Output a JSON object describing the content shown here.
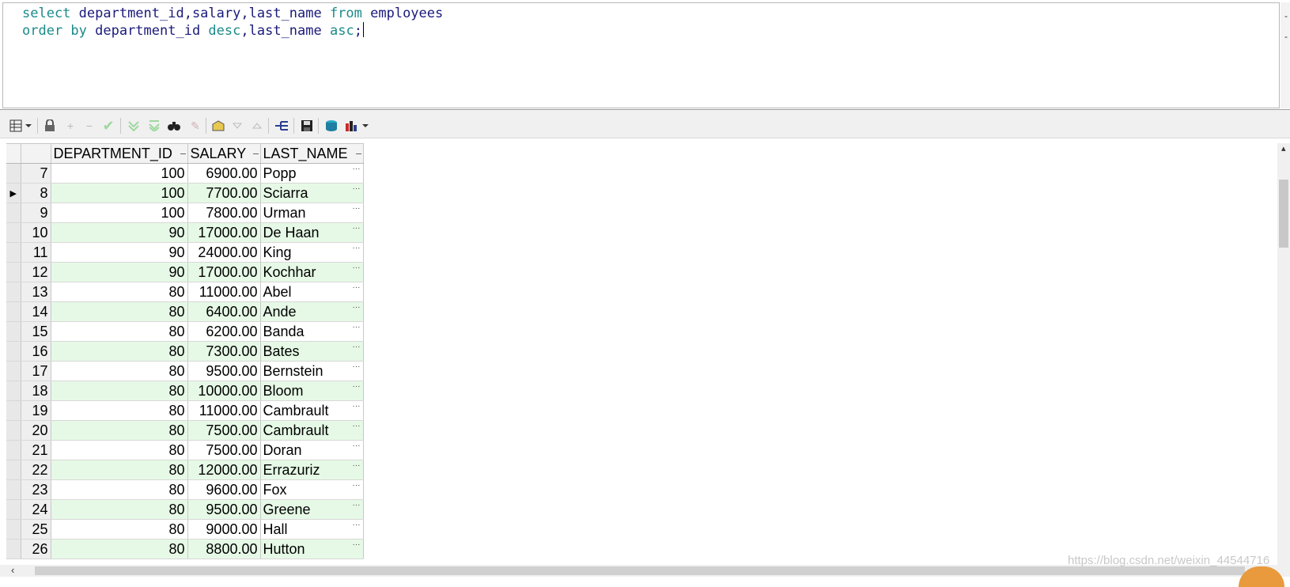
{
  "editor": {
    "line1": {
      "kw1": "select",
      "t1": " department_id,salary,last_name ",
      "kw2": "from",
      "t2": " employees"
    },
    "line2": {
      "kw1": "order by",
      "t1": " department_id ",
      "kw2": "desc",
      "t2": ",last_name ",
      "kw3": "asc",
      "t3": ";"
    }
  },
  "toolbar": {
    "icons": [
      "grid-view-icon",
      "dropdown-icon",
      "lock-icon",
      "add-row-icon",
      "delete-row-icon",
      "post-changes-icon",
      "fetch-next-icon",
      "fetch-all-icon",
      "find-icon",
      "clear-icon",
      "export-icon",
      "sort-desc-icon",
      "sort-asc-icon",
      "query-structure-icon",
      "save-icon",
      "connect-icon",
      "chart-icon"
    ]
  },
  "grid": {
    "columns": [
      "DEPARTMENT_ID",
      "SALARY",
      "LAST_NAME"
    ],
    "current_row": 8,
    "rows": [
      {
        "n": "7",
        "dept": "100",
        "salary": "6900.00",
        "name": "Popp"
      },
      {
        "n": "8",
        "dept": "100",
        "salary": "7700.00",
        "name": "Sciarra"
      },
      {
        "n": "9",
        "dept": "100",
        "salary": "7800.00",
        "name": "Urman"
      },
      {
        "n": "10",
        "dept": "90",
        "salary": "17000.00",
        "name": "De Haan"
      },
      {
        "n": "11",
        "dept": "90",
        "salary": "24000.00",
        "name": "King"
      },
      {
        "n": "12",
        "dept": "90",
        "salary": "17000.00",
        "name": "Kochhar"
      },
      {
        "n": "13",
        "dept": "80",
        "salary": "11000.00",
        "name": "Abel"
      },
      {
        "n": "14",
        "dept": "80",
        "salary": "6400.00",
        "name": "Ande"
      },
      {
        "n": "15",
        "dept": "80",
        "salary": "6200.00",
        "name": "Banda"
      },
      {
        "n": "16",
        "dept": "80",
        "salary": "7300.00",
        "name": "Bates"
      },
      {
        "n": "17",
        "dept": "80",
        "salary": "9500.00",
        "name": "Bernstein"
      },
      {
        "n": "18",
        "dept": "80",
        "salary": "10000.00",
        "name": "Bloom"
      },
      {
        "n": "19",
        "dept": "80",
        "salary": "11000.00",
        "name": "Cambrault"
      },
      {
        "n": "20",
        "dept": "80",
        "salary": "7500.00",
        "name": "Cambrault"
      },
      {
        "n": "21",
        "dept": "80",
        "salary": "7500.00",
        "name": "Doran"
      },
      {
        "n": "22",
        "dept": "80",
        "salary": "12000.00",
        "name": "Errazuriz"
      },
      {
        "n": "23",
        "dept": "80",
        "salary": "9600.00",
        "name": "Fox"
      },
      {
        "n": "24",
        "dept": "80",
        "salary": "9500.00",
        "name": "Greene"
      },
      {
        "n": "25",
        "dept": "80",
        "salary": "9000.00",
        "name": "Hall"
      },
      {
        "n": "26",
        "dept": "80",
        "salary": "8800.00",
        "name": "Hutton"
      }
    ]
  },
  "watermark": "https://blog.csdn.net/weixin_44544716",
  "colors": {
    "keyword": "#1c8a8a",
    "identifier": "#1a1a7a",
    "alt_row": "#e6f9e6"
  }
}
